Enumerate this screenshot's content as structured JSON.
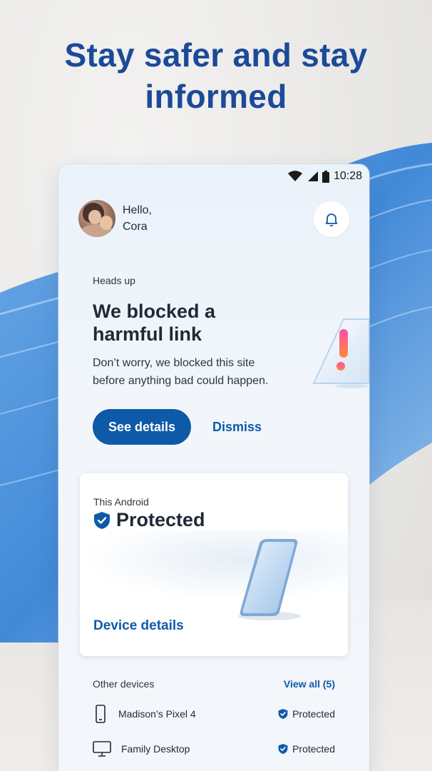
{
  "headline": {
    "line1": "Stay safer and stay",
    "line2": "informed"
  },
  "status_bar": {
    "time": "10:28"
  },
  "greeting": {
    "hello": "Hello,",
    "name": "Cora"
  },
  "alert": {
    "eyebrow": "Heads up",
    "title_line1": "We blocked a",
    "title_line2": "harmful link",
    "desc_line1": "Don’t worry, we blocked this site",
    "desc_line2": "before anything bad could happen.",
    "primary_button": "See details",
    "secondary_button": "Dismiss"
  },
  "device_card": {
    "label": "This Android",
    "status": "Protected",
    "link": "Device details"
  },
  "other_devices": {
    "title": "Other devices",
    "view_all": "View all (5)",
    "items": [
      {
        "name": "Madison’s Pixel 4",
        "status": "Protected",
        "icon": "smartphone-icon"
      },
      {
        "name": "Family Desktop",
        "status": "Protected",
        "icon": "desktop-monitor-icon"
      }
    ]
  },
  "colors": {
    "brand_blue": "#1b4a99",
    "accent": "#0f5aa8",
    "text": "#1f2a37"
  }
}
